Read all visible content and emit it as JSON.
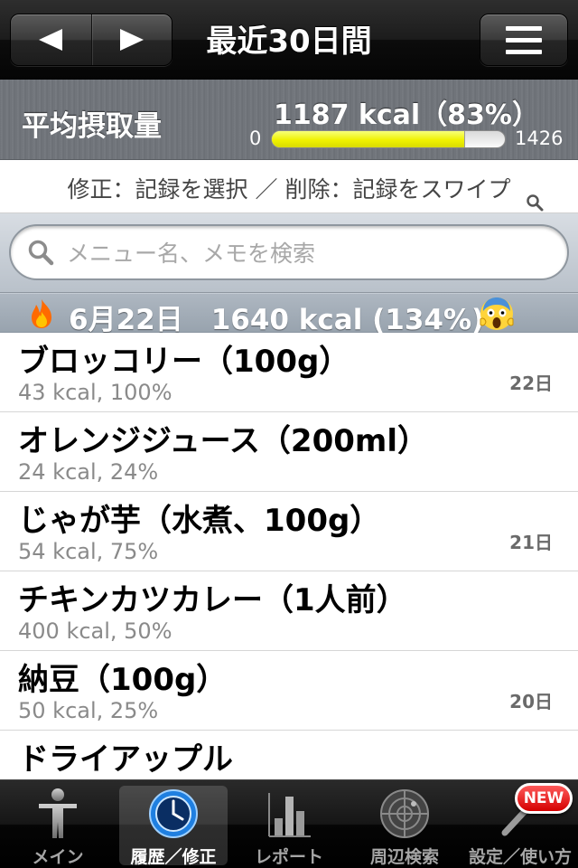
{
  "nav": {
    "title": "最近30日間",
    "back_icon": "triangle-left-icon",
    "forward_icon": "triangle-right-icon",
    "menu_icon": "hamburger-menu-icon"
  },
  "summary": {
    "label": "平均摂取量",
    "value": "1187 kcal（83%）",
    "bar_min": "0",
    "bar_max": "1426",
    "progress_fraction": 0.83,
    "bar_color": "#f0f200"
  },
  "hint": {
    "text": "修正：記録を選択 ／ 削除：記録をスワイプ"
  },
  "search": {
    "placeholder": "メニュー名、メモを検索",
    "value": ""
  },
  "section": {
    "text": "6月22日　1640 kcal (134%)",
    "left_icon": "fire-icon",
    "right_icon": "screaming-face-icon"
  },
  "items": [
    {
      "title": "ブロッコリー（100g）",
      "sub": "43 kcal, 100%",
      "day": "22日"
    },
    {
      "title": "オレンジジュース（200ml）",
      "sub": "24 kcal, 24%",
      "day": ""
    },
    {
      "title": "じゃが芋（水煮、100g）",
      "sub": "54 kcal, 75%",
      "day": "21日"
    },
    {
      "title": "チキンカツカレー（1人前）",
      "sub": "400 kcal, 50%",
      "day": ""
    },
    {
      "title": "納豆（100g）",
      "sub": "50 kcal, 25%",
      "day": "20日"
    },
    {
      "title": "ドライアップル",
      "sub": "",
      "day": ""
    }
  ],
  "tabs": [
    {
      "label": "メイン",
      "icon": "person-icon",
      "active": false
    },
    {
      "label": "履歴／修正",
      "icon": "clock-icon",
      "active": true
    },
    {
      "label": "レポート",
      "icon": "bar-chart-icon",
      "active": false
    },
    {
      "label": "周辺検索",
      "icon": "radar-icon",
      "active": false
    },
    {
      "label": "設定／使い方",
      "icon": "wrench-icon",
      "active": false
    }
  ],
  "new_badge": "NEW"
}
